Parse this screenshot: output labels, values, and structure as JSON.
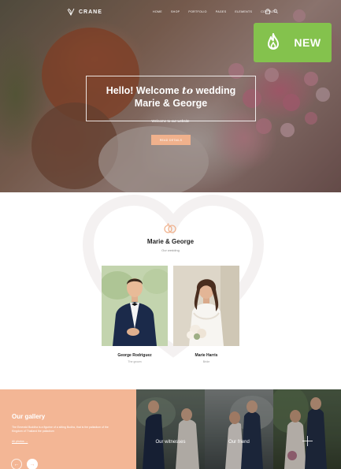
{
  "brand": {
    "name": "CRANE"
  },
  "nav": {
    "items": [
      "HOME",
      "SHOP",
      "PORTFOLIO",
      "PAGES",
      "ELEMENTS",
      "CONTACT"
    ],
    "icons": [
      "bag-icon",
      "search-icon"
    ]
  },
  "badge": {
    "label": "NEW",
    "color": "#84c24d",
    "icon": "flame-icon"
  },
  "hero": {
    "title_part1": "Hello! Welcome ",
    "title_italic": "to",
    "title_part2": " wedding",
    "title_line2": "Marie & George",
    "subtitle": "Welcome to our website",
    "button_label": "READ DETAILS",
    "button_color": "#f0b18c"
  },
  "couple": {
    "title": "Marie & George",
    "subtitle": "Our wedding",
    "people": [
      {
        "name": "George Rodriguez",
        "role": "The groom"
      },
      {
        "name": "Marie Harris",
        "role": "Bride"
      }
    ]
  },
  "gallery": {
    "title": "Our gallery",
    "description": "The Emerald Buddha is a figurine of a sitting Budha, that is the palladium of the Kingdom of Thailand the palladium",
    "link_label": "All photos →",
    "accent": "#f3b695",
    "tiles": [
      {
        "label": "Our witnesses"
      },
      {
        "label": "Our friend"
      },
      {
        "label": "",
        "icon": "plus-icon"
      }
    ]
  }
}
